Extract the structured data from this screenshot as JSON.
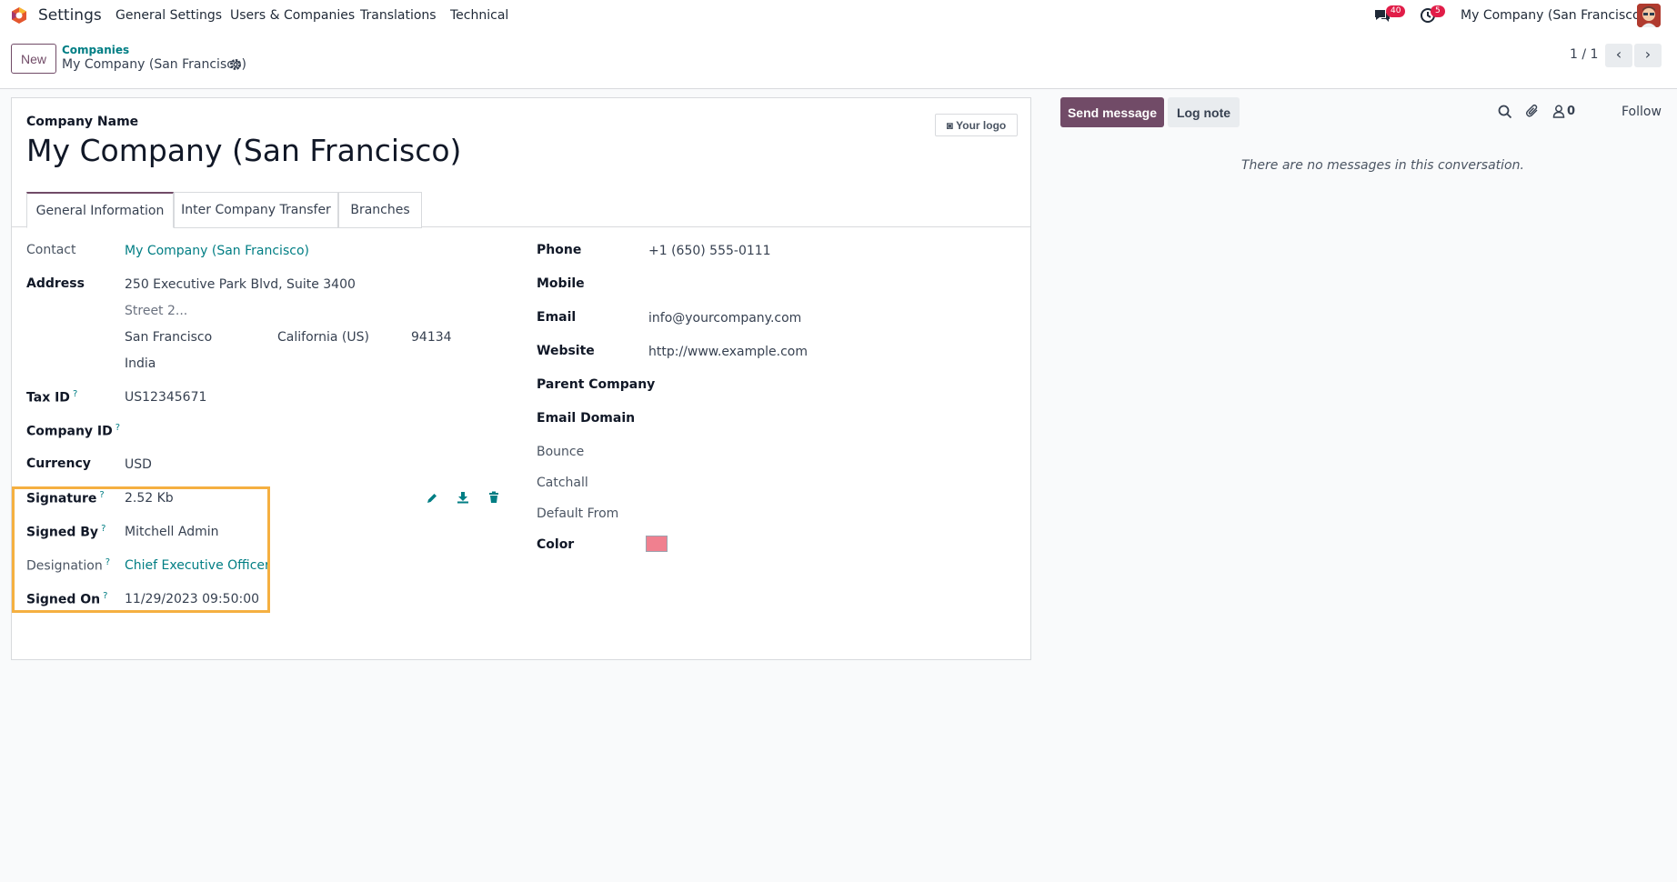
{
  "topnav": {
    "app_name": "Settings",
    "menu": [
      "General Settings",
      "Users & Companies",
      "Translations",
      "Technical"
    ],
    "messages_count": "40",
    "activities_count": "5",
    "company_switch": "My Company (San Francisco)"
  },
  "control_panel": {
    "new_label": "New",
    "breadcrumb_parent": "Companies",
    "breadcrumb_current": "My Company (San Francisco)",
    "pager": "1 / 1"
  },
  "form": {
    "company_name_label": "Company Name",
    "company_name": "My Company (San Francisco)",
    "logo_button": "Your logo",
    "tabs": [
      "General Information",
      "Inter Company Transfer",
      "Branches"
    ],
    "left": {
      "contact_label": "Contact",
      "contact_value": "My Company (San Francisco)",
      "address_label": "Address",
      "street": "250 Executive Park Blvd, Suite 3400",
      "street2_placeholder": "Street 2...",
      "city": "San Francisco",
      "state": "California (US)",
      "zip": "94134",
      "country": "India",
      "tax_id_label": "Tax ID",
      "tax_id_value": "US12345671",
      "company_id_label": "Company ID",
      "company_id_value": "",
      "currency_label": "Currency",
      "currency_value": "USD",
      "signature_label": "Signature",
      "signature_value": "2.52 Kb",
      "signed_by_label": "Signed By",
      "signed_by_value": "Mitchell Admin",
      "designation_label": "Designation",
      "designation_value": "Chief Executive Officer",
      "signed_on_label": "Signed On",
      "signed_on_value": "11/29/2023 09:50:00",
      "help_mark": "?"
    },
    "right": {
      "phone_label": "Phone",
      "phone_value": "+1 (650) 555-0111",
      "mobile_label": "Mobile",
      "email_label": "Email",
      "email_value": "info@yourcompany.com",
      "website_label": "Website",
      "website_value": "http://www.example.com",
      "parent_company_label": "Parent Company",
      "email_domain_label": "Email Domain",
      "bounce_label": "Bounce",
      "catchall_label": "Catchall",
      "default_from_label": "Default From",
      "color_label": "Color",
      "color_value": "#f0808f"
    }
  },
  "chatter": {
    "send_message": "Send message",
    "log_note": "Log note",
    "followers_count": "0",
    "follow": "Follow",
    "empty_message": "There are no messages in this conversation."
  },
  "colors": {
    "brand": "#714b67",
    "link": "#017e84",
    "highlight": "#f5b041",
    "badge": "#e11d48"
  }
}
